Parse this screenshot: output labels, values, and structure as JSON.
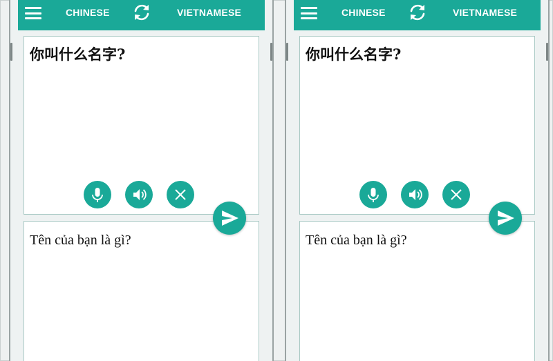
{
  "screens": [
    {
      "header": {
        "menu_icon": "hamburger-menu-icon",
        "source_language": "CHINESE",
        "swap_icon": "swap-languages-icon",
        "target_language": "VIETNAMESE"
      },
      "input": {
        "text": "你叫什么名字?"
      },
      "actions": [
        "microphone-icon",
        "speaker-icon",
        "clear-icon"
      ],
      "send_icon": "send-icon",
      "output": {
        "text": "Tên của bạn là gì?"
      }
    },
    {
      "header": {
        "menu_icon": "hamburger-menu-icon",
        "source_language": "CHINESE",
        "swap_icon": "swap-languages-icon",
        "target_language": "VIETNAMESE"
      },
      "input": {
        "text": "你叫什么名字?"
      },
      "actions": [
        "microphone-icon",
        "speaker-icon",
        "clear-icon"
      ],
      "send_icon": "send-icon",
      "output": {
        "text": "Tên của bạn là gì?"
      }
    }
  ],
  "colors": {
    "accent": "#1aa998",
    "panel_border": "#a9c9c4"
  }
}
